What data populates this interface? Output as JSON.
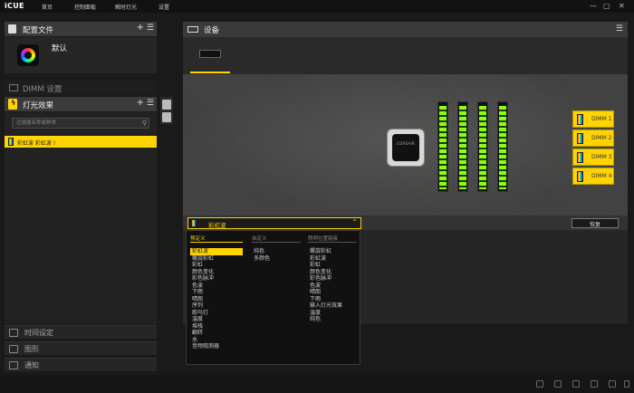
{
  "app": {
    "brand": "iCUE"
  },
  "nav": {
    "home": "首页",
    "dashboard": "控制面板",
    "instant_lighting": "瞬时灯光",
    "settings": "设置"
  },
  "window": {
    "minimize": "—",
    "maximize": "▢",
    "close": "✕"
  },
  "profiles": {
    "title": "配置文件",
    "add": "+",
    "menu": "☰",
    "current": "默认"
  },
  "dimm_settings": {
    "title": "DIMM 设置"
  },
  "lighting_effects": {
    "title": "灯光效果",
    "add": "+",
    "menu": "☰",
    "filter_placeholder": "过滤器名称或种类",
    "selected_item": "彩虹波  彩虹波 !"
  },
  "bottom_panels": {
    "time": "时间设定",
    "graphics": "图形",
    "notifications": "通知"
  },
  "devices": {
    "title": "设备",
    "menu": "☰",
    "cooler_logo": "CORSAIR",
    "dimm_labels": [
      "DIMM 1",
      "DIMM 2",
      "DIMM 3",
      "DIMM 4"
    ]
  },
  "editor": {
    "selected_effect": "彩虹波",
    "chevron": "⌃",
    "reset": "恢复"
  },
  "dropdown": {
    "columns": [
      {
        "header": "预定义",
        "items": [
          "彩虹波",
          "螺旋彩虹",
          "彩虹",
          "颜色变化",
          "彩色脉冲",
          "色波",
          "下雨",
          "晴朗",
          "序列",
          "跑马灯",
          "温度",
          "堆栈",
          "翻转",
          "水",
          "音频观测器"
        ]
      },
      {
        "header": "自定义",
        "items": [
          "纯色",
          "多颜色"
        ]
      },
      {
        "header": "照明位置链接",
        "items": [
          "螺旋彩虹",
          "彩虹波",
          "彩虹",
          "颜色变化",
          "彩色脉冲",
          "色波",
          "晴朗",
          "下雨",
          "输入灯光效果",
          "温度",
          "纯色"
        ]
      }
    ],
    "selected_index": 0
  },
  "colors": {
    "accent": "#ffd400",
    "background": "#1a1a1a",
    "panel_header": "#3a3a3a",
    "ram_led": "#8bff10"
  }
}
